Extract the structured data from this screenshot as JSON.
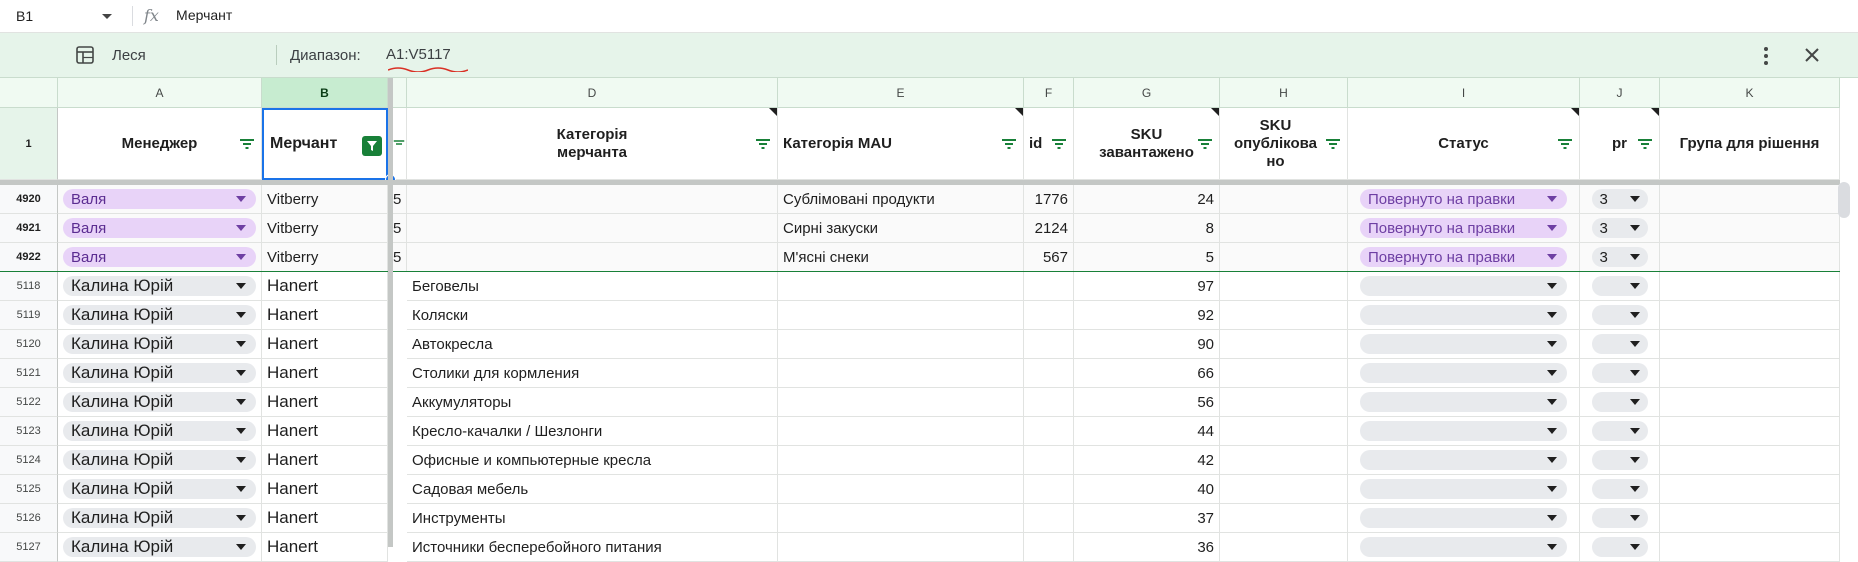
{
  "formula_bar": {
    "name_box": "B1",
    "fx": "fx",
    "value": "Мерчант"
  },
  "filter_view": {
    "name": "Леся",
    "range_label": "Диапазон:",
    "range_value": "A1:V5117"
  },
  "columns": [
    "A",
    "B",
    "D",
    "E",
    "F",
    "G",
    "H",
    "I",
    "J",
    "K"
  ],
  "header": {
    "row_num": "1",
    "cells": [
      "Менеджер",
      "Мерчант",
      "Категорія мерчанта",
      "Категорія MAU",
      "id",
      "SKU завантажено",
      "SKU опублікова но",
      "Статус",
      "pr",
      "Група для рішення"
    ]
  },
  "frozen_rows": [
    {
      "num": "4920",
      "manager": "Валя",
      "merchant": "Vitberry",
      "c": "5",
      "cat": "",
      "mau": "Сублімовані продукти",
      "id": "1776",
      "sku": "24",
      "status": "Повернуто на правки",
      "pr": "3"
    },
    {
      "num": "4921",
      "manager": "Валя",
      "merchant": "Vitberry",
      "c": "5",
      "cat": "",
      "mau": "Сирні закуски",
      "id": "2124",
      "sku": "8",
      "status": "Повернуто на правки",
      "pr": "3"
    },
    {
      "num": "4922",
      "manager": "Валя",
      "merchant": "Vitberry",
      "c": "5",
      "cat": "",
      "mau": "М'ясні снеки",
      "id": "567",
      "sku": "5",
      "status": "Повернуто на правки",
      "pr": "3"
    }
  ],
  "rows": [
    {
      "num": "5118",
      "manager": "Калина Юрій",
      "merchant": "Hanert",
      "cat": "Беговелы",
      "sku": "97"
    },
    {
      "num": "5119",
      "manager": "Калина Юрій",
      "merchant": "Hanert",
      "cat": "Коляски",
      "sku": "92"
    },
    {
      "num": "5120",
      "manager": "Калина Юрій",
      "merchant": "Hanert",
      "cat": "Автокресла",
      "sku": "90"
    },
    {
      "num": "5121",
      "manager": "Калина Юрій",
      "merchant": "Hanert",
      "cat": "Столики для кормления",
      "sku": "66"
    },
    {
      "num": "5122",
      "manager": "Калина Юрій",
      "merchant": "Hanert",
      "cat": "Аккумуляторы",
      "sku": "56"
    },
    {
      "num": "5123",
      "manager": "Калина Юрій",
      "merchant": "Hanert",
      "cat": "Кресло-качалки / Шезлонги",
      "sku": "44"
    },
    {
      "num": "5124",
      "manager": "Калина Юрій",
      "merchant": "Hanert",
      "cat": "Офисные и компьютерные кресла",
      "sku": "42"
    },
    {
      "num": "5125",
      "manager": "Калина Юрій",
      "merchant": "Hanert",
      "cat": "Садовая мебель",
      "sku": "40"
    },
    {
      "num": "5126",
      "manager": "Калина Юрій",
      "merchant": "Hanert",
      "cat": "Инструменты",
      "sku": "37"
    },
    {
      "num": "5127",
      "manager": "Калина Юрій",
      "merchant": "Hanert",
      "cat": "Источники бесперебойного питания",
      "sku": "36"
    }
  ],
  "colors": {
    "accent": "#1a73e8",
    "filter_green": "#188038",
    "chip_purple": "#e8d3f8",
    "viewbar_bg": "#e6f4ea"
  }
}
